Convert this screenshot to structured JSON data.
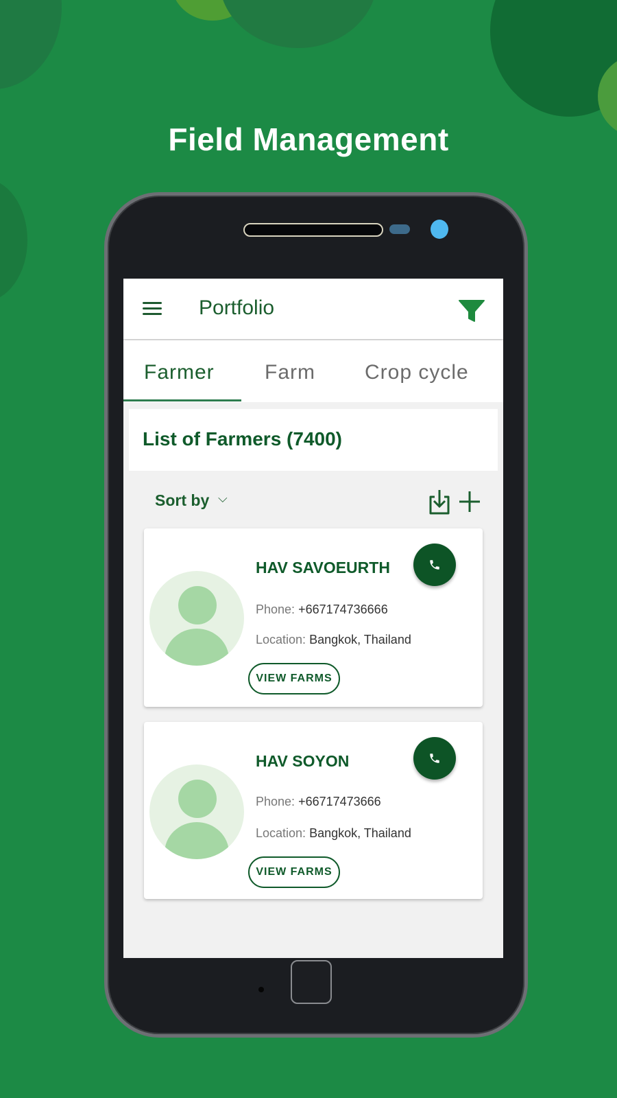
{
  "headline": "Field Management",
  "app": {
    "title": "Portfolio",
    "tabs": [
      {
        "label": "Farmer",
        "active": true
      },
      {
        "label": "Farm",
        "active": false
      },
      {
        "label": "Crop cycle",
        "active": false
      }
    ],
    "list_title": "List of Farmers (7400)",
    "sort_label": "Sort by",
    "sort_chevron": "⌵",
    "icons": {
      "menu": "menu-icon",
      "filter": "filter-icon",
      "download": "download-icon",
      "add": "add-icon",
      "call": "phone-icon",
      "avatar": "person-icon"
    },
    "phone_label": "Phone: ",
    "location_label": "Location: ",
    "view_farms_label": "VIEW FARMS",
    "farmers": [
      {
        "name": "HAV SAVOEURTH",
        "phone": "+667174736666",
        "location": "Bangkok, Thailand"
      },
      {
        "name": "HAV SOYON",
        "phone": "+66717473666",
        "location": "Bangkok, Thailand"
      }
    ]
  },
  "colors": {
    "background": "#1c8a45",
    "primary": "#0f5a2a",
    "accent": "#1e8a3e",
    "avatar_fill": "#a5d7a4"
  }
}
